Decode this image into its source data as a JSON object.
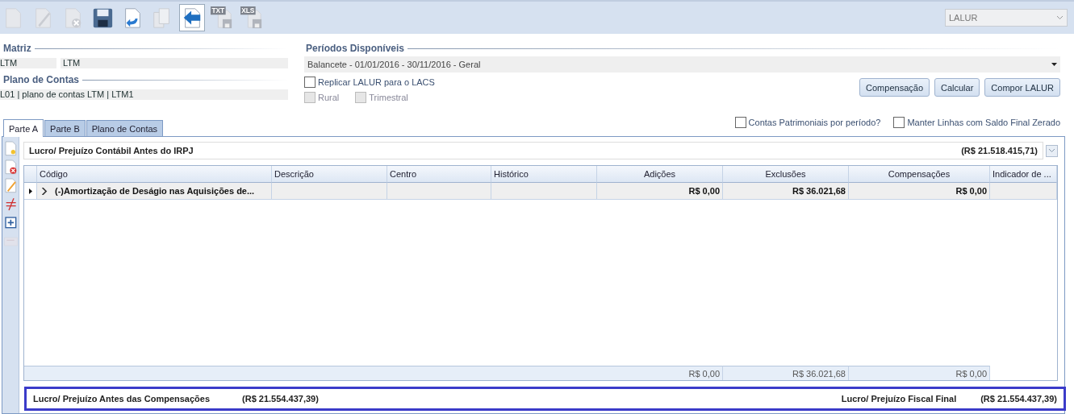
{
  "toolbar": {
    "buttons": [
      {
        "kind": "new",
        "disabled": true
      },
      {
        "kind": "edit",
        "disabled": true
      },
      {
        "kind": "delete",
        "disabled": true
      },
      {
        "kind": "save",
        "disabled": false
      },
      {
        "kind": "undo",
        "disabled": false
      },
      {
        "kind": "copy",
        "disabled": true
      },
      {
        "kind": "back",
        "disabled": false,
        "selected": true
      },
      {
        "kind": "export",
        "badge": "TXT",
        "disabled": true
      },
      {
        "kind": "export",
        "badge": "XLS",
        "disabled": true
      }
    ],
    "report_select": {
      "value": "LALUR",
      "disabled": true
    }
  },
  "matriz": {
    "title": "Matriz",
    "code": "LTM",
    "name": "LTM"
  },
  "plano_de_contas": {
    "title": "Plano de Contas",
    "value": "L01 | plano de contas LTM | LTM1"
  },
  "periodos": {
    "title": "Períodos Disponíveis",
    "value": "Balancete - 01/01/2016 - 30/11/2016 - Geral"
  },
  "options": [
    {
      "label": "Replicar LALUR para o LACS",
      "checked": false,
      "disabled": false
    },
    {
      "label": "Rural",
      "checked": false,
      "disabled": true
    },
    {
      "label": "Trimestral",
      "checked": false,
      "disabled": true
    }
  ],
  "buttons": [
    "Compensação",
    "Calcular",
    "Compor LALUR"
  ],
  "tabs": [
    {
      "label": "Parte A",
      "selected": true
    },
    {
      "label": "Parte B",
      "selected": false
    },
    {
      "label": "Plano de Contas",
      "selected": false
    }
  ],
  "grid_options": [
    {
      "label": "Contas Patrimoniais por período?",
      "checked": false
    },
    {
      "label": "Manter Linhas com Saldo Final Zerado",
      "checked": false
    }
  ],
  "side_tools": [
    {
      "kind": "new",
      "disabled": false
    },
    {
      "kind": "delete",
      "disabled": false
    },
    {
      "kind": "edit",
      "disabled": false
    },
    {
      "kind": "not-equal",
      "disabled": false
    },
    {
      "kind": "expand",
      "disabled": false
    },
    {
      "kind": "move",
      "disabled": true
    }
  ],
  "group": {
    "title": "Lucro/ Prejuízo Contábil Antes do IRPJ",
    "value": "(R$ 21.518.415,71)"
  },
  "table": {
    "columns": [
      "Código",
      "Descrição",
      "Centro",
      "Histórico",
      "Adições",
      "Exclusões",
      "Compensações",
      "Indicador de ..."
    ],
    "rows": [
      {
        "selected": true,
        "expanded": false,
        "cells": [
          "(-)Amortização de Deságio nas Aquisições de...",
          "",
          "",
          "",
          "R$ 0,00",
          "R$ 36.021,68",
          "R$ 0,00",
          ""
        ]
      }
    ],
    "totals": [
      "R$ 0,00",
      "R$ 36.021,68",
      "R$ 0,00"
    ]
  },
  "summary": [
    {
      "label": "Lucro/ Prejuízo Antes das Compensações",
      "value": "(R$ 21.554.437,39)"
    },
    {
      "label": "Lucro/ Prejuízo Fiscal Final",
      "value": "(R$ 21.554.437,39)"
    }
  ]
}
